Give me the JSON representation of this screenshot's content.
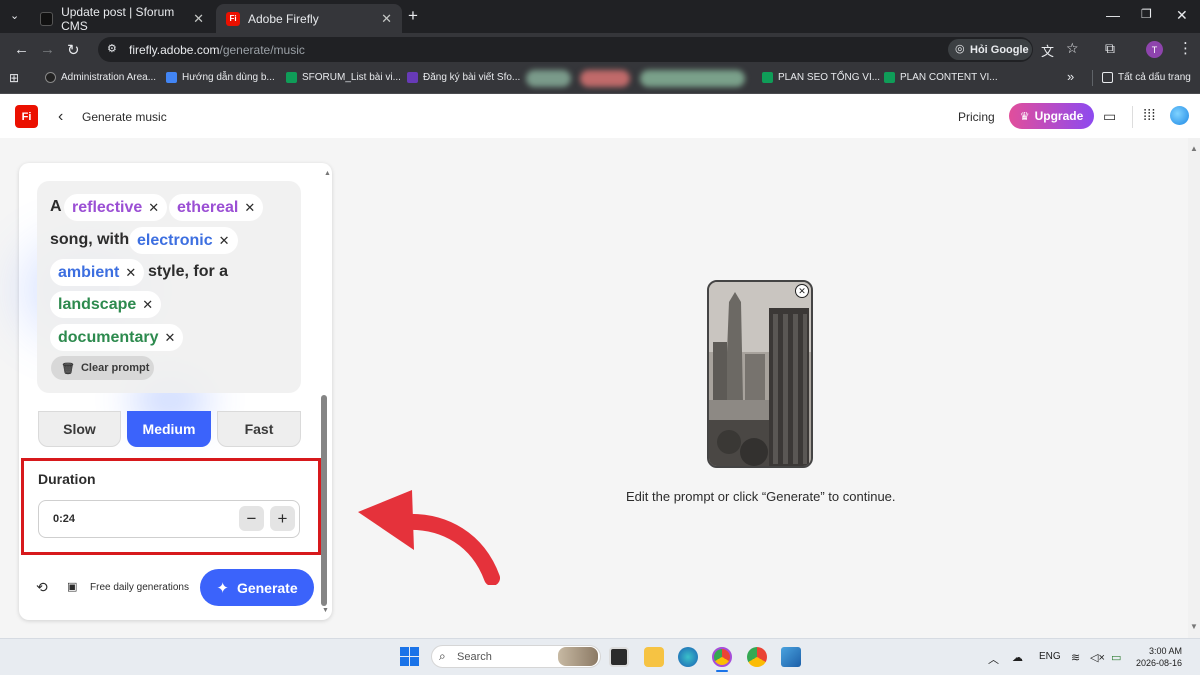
{
  "browser": {
    "tabs": [
      {
        "title": "Update post | Sforum CMS"
      },
      {
        "title": "Adobe Firefly"
      }
    ],
    "url_host": "firefly.adobe.com",
    "url_path": "/generate/music",
    "translate_chip": "Hỏi Google",
    "profile_initial": "T",
    "bookmarks": [
      "Administration Area...",
      "Hướng dẫn dùng b...",
      "SFORUM_List bài vi...",
      "Đăng ký bài viết Sfo...",
      "PLAN SEO TỔNG VI...",
      "PLAN CONTENT VI..."
    ],
    "bookmarks_more": "»",
    "all_bookmarks": "Tất cả dấu trang"
  },
  "header": {
    "logo": "Fi",
    "title": "Generate music",
    "pricing": "Pricing",
    "upgrade": "Upgrade"
  },
  "prompt": {
    "word_a": "A",
    "chip1": "reflective",
    "chip2": "ethereal",
    "text_song": "song, with",
    "chip3": "electronic",
    "chip4": "ambient",
    "text_style": "style, for a",
    "chip5": "landscape",
    "chip6": "documentary",
    "clear": "Clear prompt"
  },
  "tempo": {
    "options": [
      "Slow",
      "Medium",
      "Fast"
    ],
    "selected": "Medium"
  },
  "duration": {
    "title": "Duration",
    "value": "0:24",
    "minus": "−",
    "plus": "+"
  },
  "footer": {
    "free": "Free daily generations",
    "generate": "Generate"
  },
  "preview": {
    "message": "Edit the prompt or click “Generate” to continue."
  },
  "taskbar": {
    "search": "Search",
    "lang": "ENG",
    "time": "3:00 AM",
    "date": "2026-08-16"
  },
  "colors": {
    "accent": "#3b63fb",
    "highlight": "#d7191c",
    "brand": "#eb1000"
  }
}
